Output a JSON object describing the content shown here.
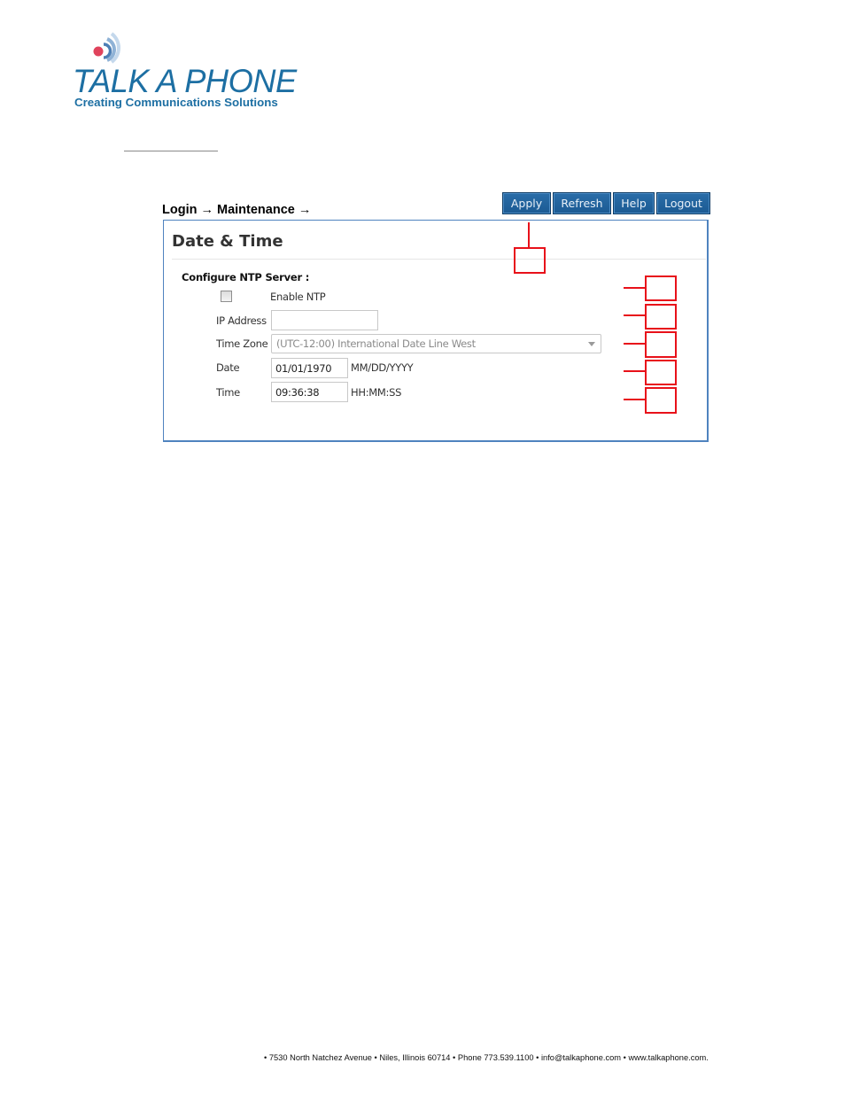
{
  "logo": {
    "title": "TALK A PHONE",
    "tagline": "Creating Communications Solutions",
    "colors": {
      "brand_blue": "#1d6fa3",
      "dot_red": "#e0435c",
      "arc_light": "#a9c6e2"
    }
  },
  "breadcrumb": "Login → Maintenance →",
  "toolbar": {
    "buttons": [
      {
        "label": "Apply"
      },
      {
        "label": "Refresh"
      },
      {
        "label": "Help"
      },
      {
        "label": "Logout"
      }
    ],
    "color": "#1f5f99"
  },
  "panel": {
    "title": "Date & Time",
    "section_label": "Configure NTP Server :",
    "enable_ntp": {
      "label": "Enable NTP",
      "checked": false
    },
    "ip_address": {
      "label": "IP Address",
      "value": ""
    },
    "time_zone": {
      "label": "Time Zone",
      "value": "(UTC-12:00) International Date Line West"
    },
    "date": {
      "label": "Date",
      "value": "01/01/1970",
      "format_hint": "MM/DD/YYYY"
    },
    "time": {
      "label": "Time",
      "value": "09:36:38",
      "format_hint": "HH:MM:SS"
    }
  },
  "callouts": {
    "count": 6,
    "color": "#e8111a"
  },
  "footer": "• 7530 North Natchez Avenue • Niles, Illinois 60714 • Phone 773.539.1100 • info@talkaphone.com • www.talkaphone.com."
}
